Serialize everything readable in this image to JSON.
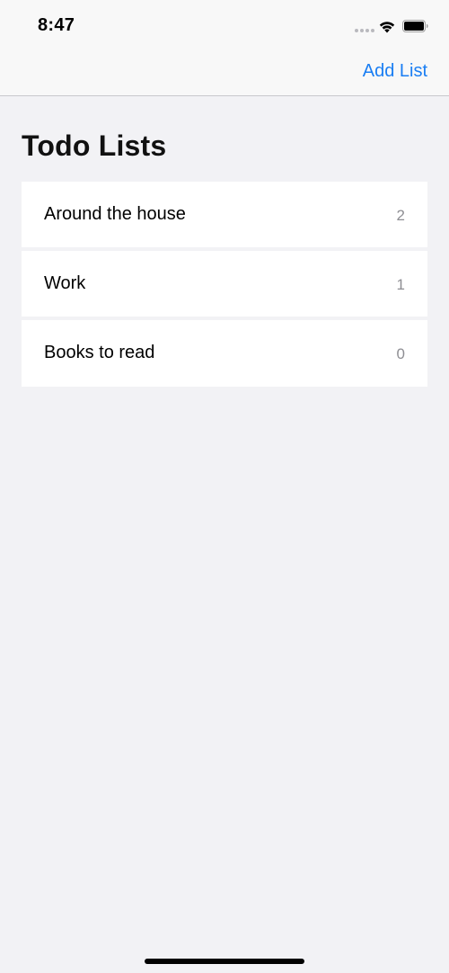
{
  "status_bar": {
    "time": "8:47",
    "icons": [
      "cellular-signal-icon",
      "wifi-icon",
      "battery-icon"
    ]
  },
  "nav_bar": {
    "add_list_label": "Add List"
  },
  "title": "Todo Lists",
  "lists": [
    {
      "name": "Around the house",
      "count": "2"
    },
    {
      "name": "Work",
      "count": "1"
    },
    {
      "name": "Books to read",
      "count": "0"
    }
  ],
  "colors": {
    "accent": "#1a7ef3",
    "background": "#f2f2f5",
    "count_text": "#8e8e93"
  }
}
